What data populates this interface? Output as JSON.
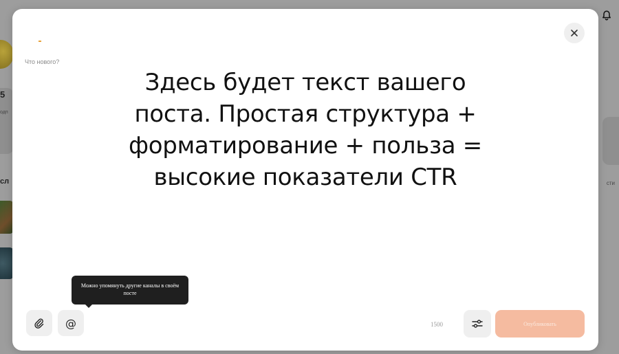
{
  "background": {
    "left_number": "5",
    "left_number_sub": "одп",
    "left_fragment": "сл",
    "right_fragment": "сти"
  },
  "modal": {
    "placeholder": "Что нового?",
    "post_text": "Здесь будет текст вашего поста. Простая структура + форматирование + польза = высокие показатели CTR",
    "tooltip": "Можно упомянуть другие каналы в своём посте",
    "mention_symbol": "@",
    "char_count": "1500",
    "publish_label": "Опубликовать"
  },
  "icons": {
    "close": "close-icon",
    "attach": "paperclip-icon",
    "settings": "sliders-icon",
    "bell": "bell-icon"
  },
  "colors": {
    "overlay": "#9d9d9d",
    "modal_bg": "#ffffff",
    "tool_button_bg": "#efefef",
    "tooltip_bg": "#1f1f1f",
    "publish_disabled": "#f5bba0",
    "accent": "#e8a23a"
  }
}
